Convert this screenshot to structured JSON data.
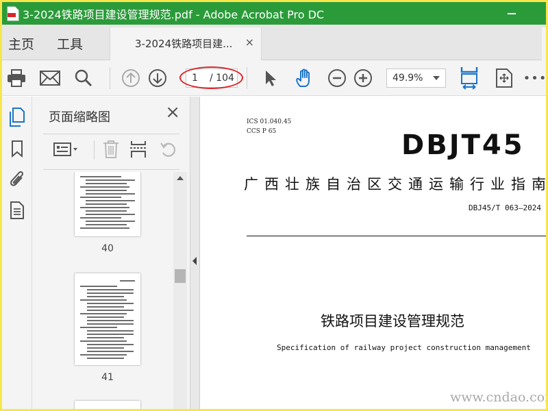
{
  "window": {
    "title": "3-2024铁路项目建设管理规范.pdf - Adobe Acrobat Pro DC",
    "colors": {
      "titlebar": "#2b9b3a",
      "frame_border": "#f7e64a",
      "accent_blue": "#1a73c8",
      "annotation_red": "#d9252a"
    }
  },
  "nav": {
    "home": "主页",
    "tools": "工具"
  },
  "tab": {
    "label": "3-2024铁路项目建...",
    "close": "×"
  },
  "toolbar": {
    "page_current": "1",
    "page_total": "/ 104",
    "zoom": "49.9%",
    "more": "•••"
  },
  "panel": {
    "title": "页面缩略图",
    "close": "×",
    "thumbnails": [
      {
        "page": "40"
      },
      {
        "page": "41"
      }
    ]
  },
  "document": {
    "ics": "ICS  01.040.45",
    "ccs": "CCS  P  65",
    "logo": "DBJT45",
    "org": "广西壮族自治区交通运输行业指南",
    "code": "DBJ45/T 063—2024",
    "title": "铁路项目建设管理规范",
    "subtitle": "Specification of railway project construction management"
  },
  "watermark": "www.cndao.com",
  "icons": [
    "app-pdf-icon",
    "minimize-icon",
    "print-icon",
    "mail-icon",
    "search-icon",
    "page-up-icon",
    "page-down-icon",
    "select-arrow-icon",
    "hand-tool-icon",
    "zoom-out-icon",
    "zoom-in-icon",
    "fit-width-icon",
    "fit-page-icon",
    "thumbnails-icon",
    "bookmark-icon",
    "attachment-icon",
    "document-info-icon",
    "options-icon",
    "trash-icon",
    "extract-icon",
    "undo-icon"
  ]
}
